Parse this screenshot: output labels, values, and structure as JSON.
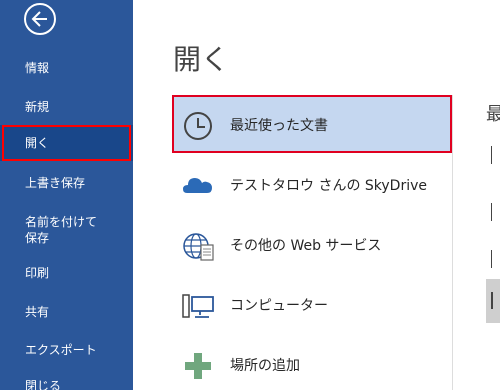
{
  "nav": {
    "items": [
      {
        "label": "情報"
      },
      {
        "label": "新規"
      },
      {
        "label": "開く"
      },
      {
        "label": "上書き保存"
      },
      {
        "label": "名前を付けて\n保存"
      },
      {
        "label": "印刷"
      },
      {
        "label": "共有"
      },
      {
        "label": "エクスポート"
      },
      {
        "label": "閉じる"
      }
    ]
  },
  "main": {
    "title": "開く",
    "places": [
      {
        "label": "最近使った文書",
        "icon": "clock-icon"
      },
      {
        "label": "テストタロウ さんの SkyDrive",
        "icon": "cloud-icon"
      },
      {
        "label": "その他の Web サービス",
        "icon": "globe-icon"
      },
      {
        "label": "コンピューター",
        "icon": "computer-icon"
      },
      {
        "label": "場所の追加",
        "icon": "plus-icon"
      }
    ],
    "right_heading": "最"
  },
  "colors": {
    "nav_background": "#2b579a",
    "nav_active": "#19478a",
    "selected_place": "#c5d7f0",
    "highlight_border": "#ff0000"
  }
}
